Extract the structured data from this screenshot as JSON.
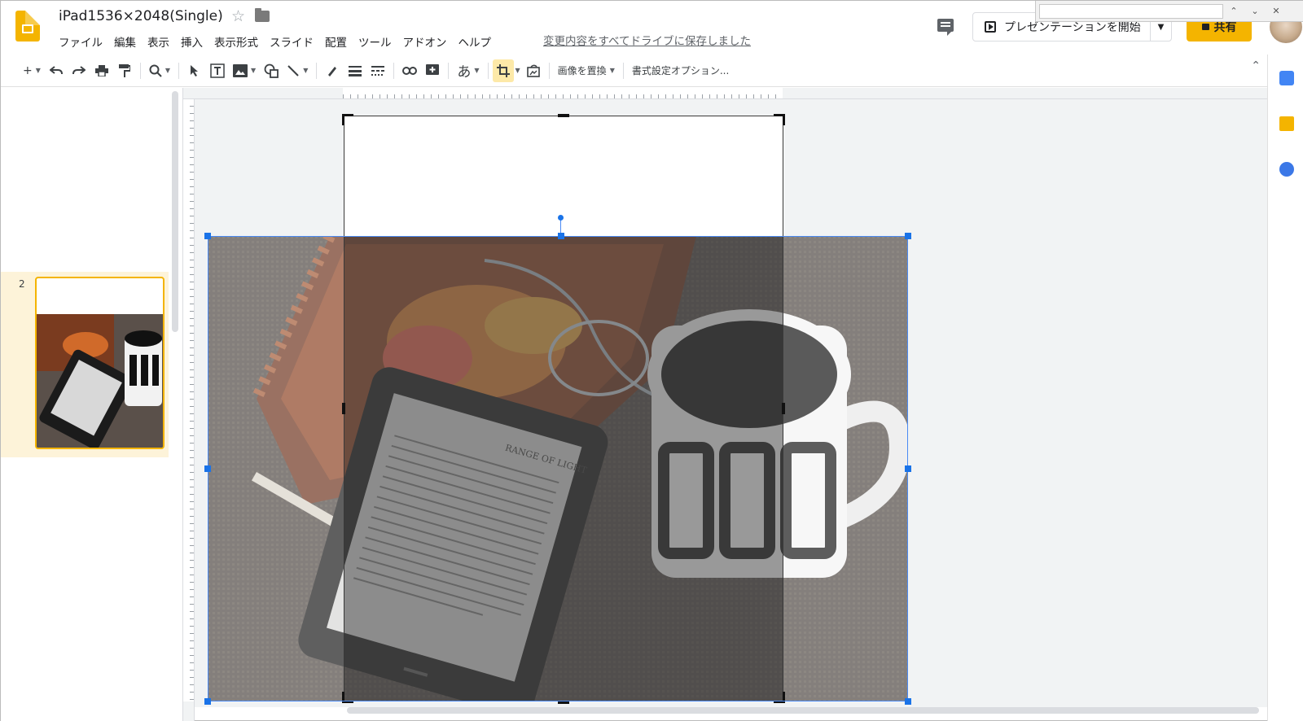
{
  "header": {
    "doc_title": "iPad1536×2048(Single)",
    "menu": [
      "ファイル",
      "編集",
      "表示",
      "挿入",
      "表示形式",
      "スライド",
      "配置",
      "ツール",
      "アドオン",
      "ヘルプ"
    ],
    "save_status": "変更内容をすべてドライブに保存しました",
    "present_label": "プレゼンテーションを開始",
    "share_label": "共有"
  },
  "toolbar": {
    "add": "+",
    "ime_char": "あ",
    "replace_image": "画像を置換",
    "format_options": "書式設定オプション..."
  },
  "filmstrip": {
    "slides": [
      {
        "number": "2",
        "selected": true
      }
    ]
  },
  "ereader": {
    "title": "RANGE OF LIGHT"
  },
  "colors": {
    "accent": "#f4b400",
    "selection": "#1a73e8",
    "crop_active_bg": "#fde9a8"
  }
}
